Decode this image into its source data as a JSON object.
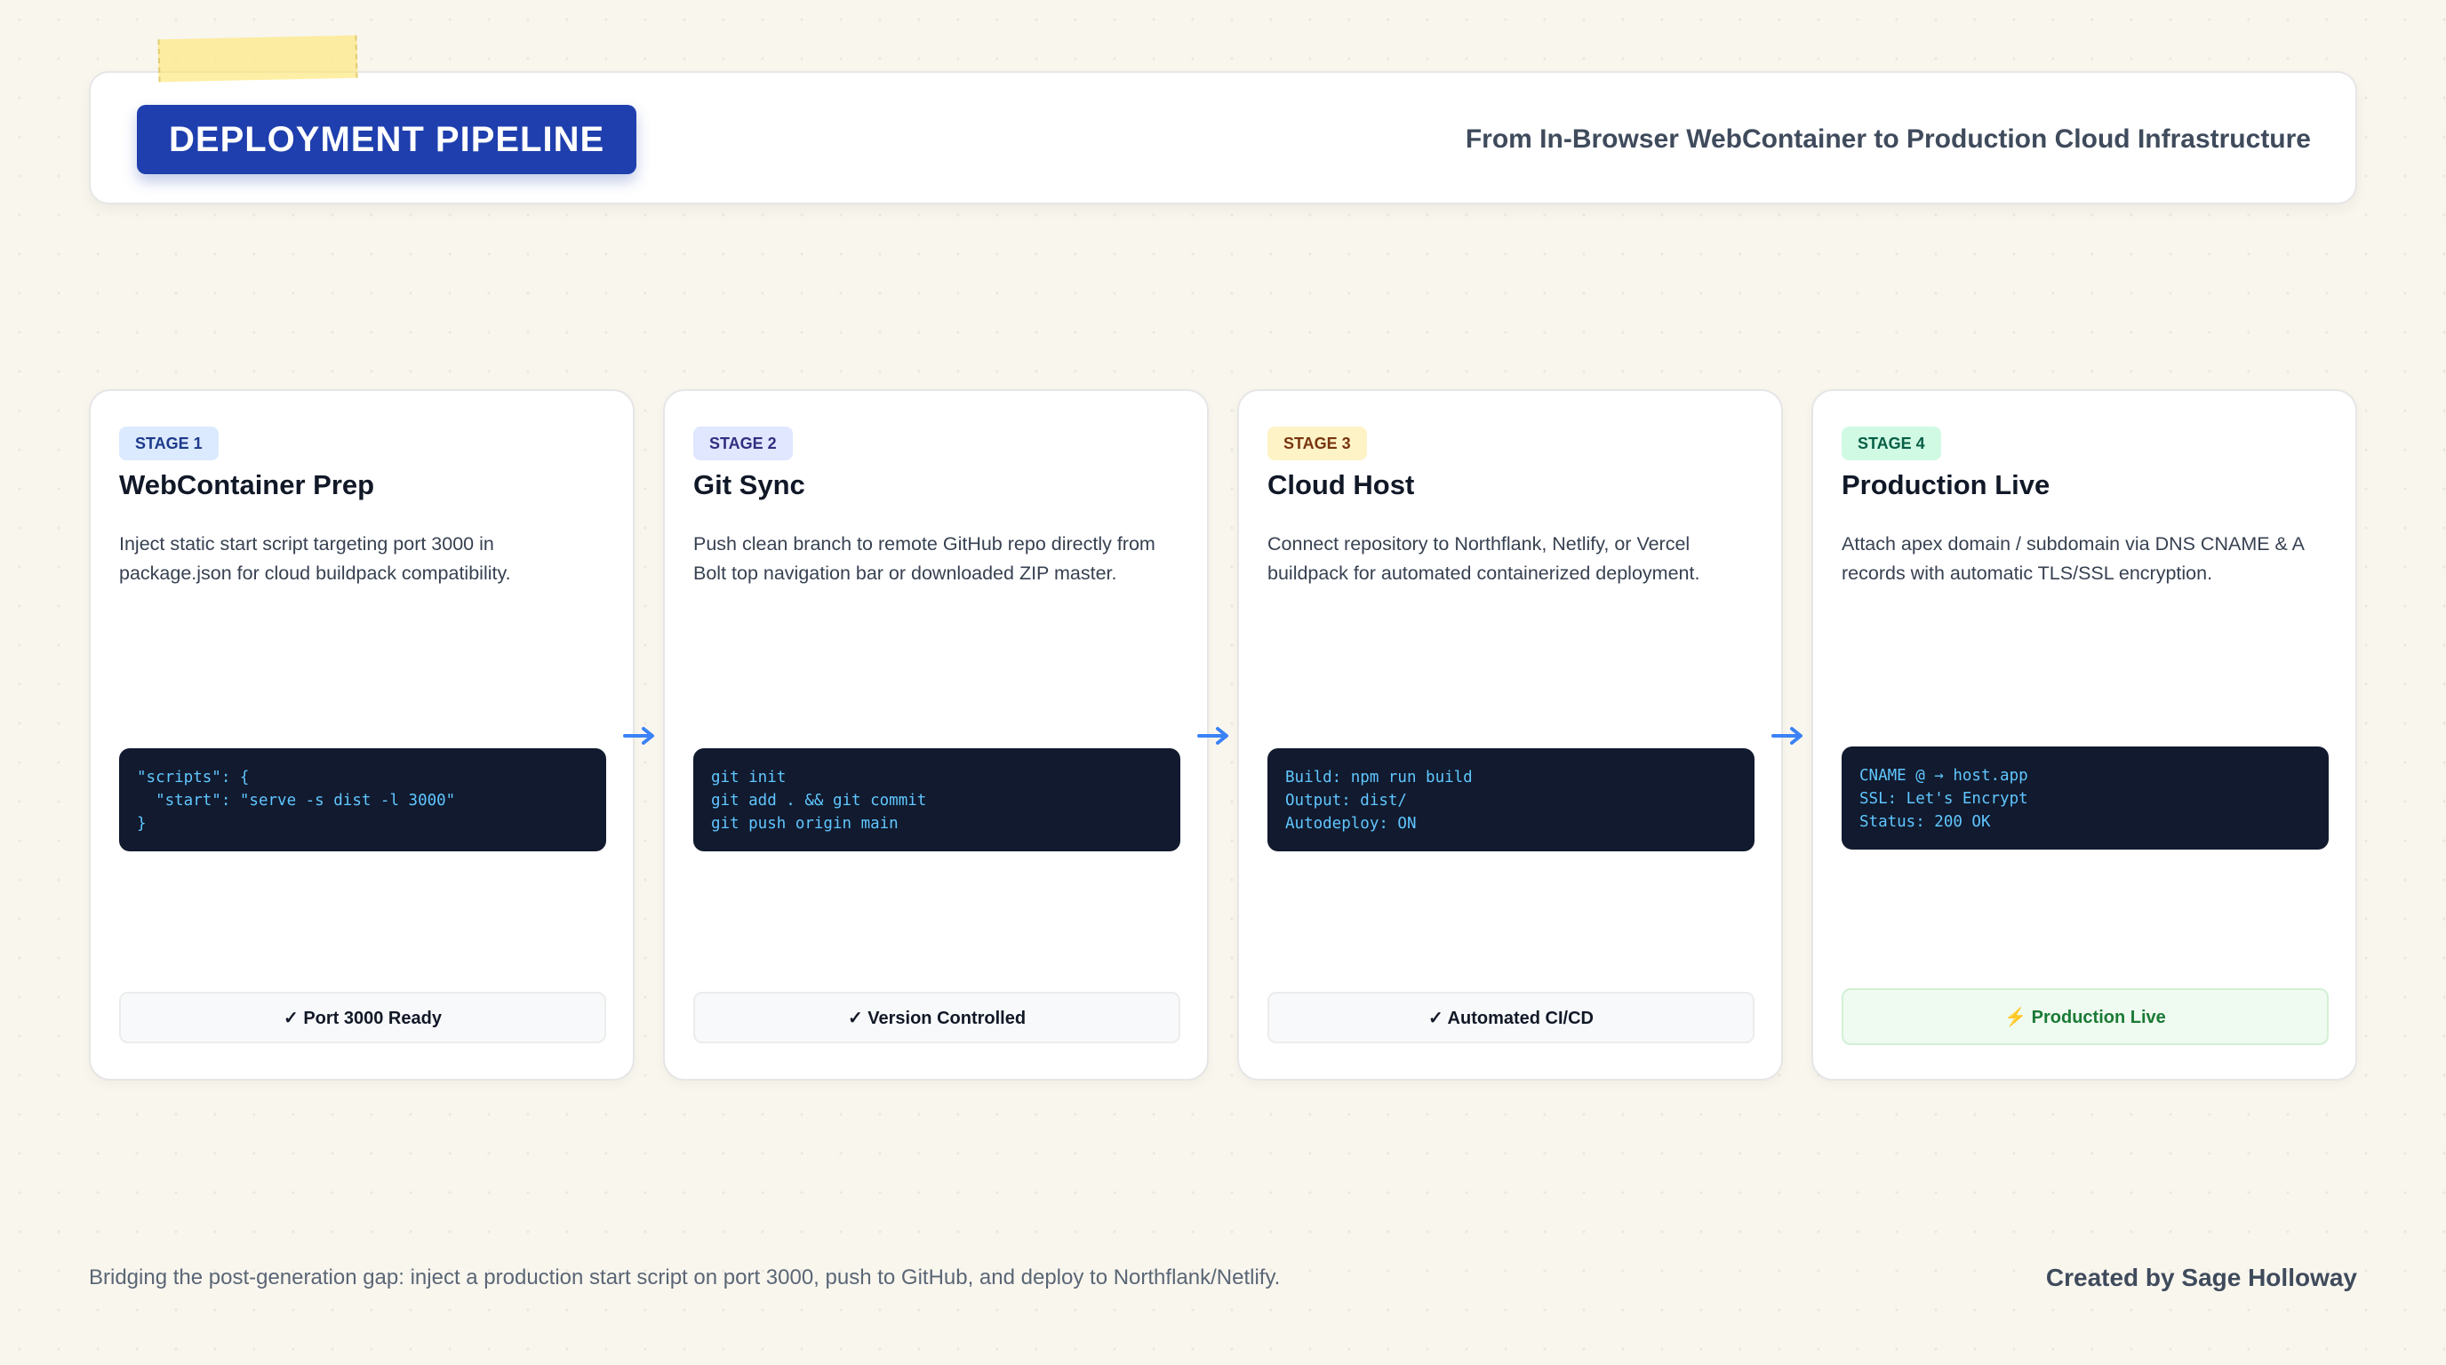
{
  "header": {
    "title": "DEPLOYMENT PIPELINE",
    "subtitle": "From In-Browser WebContainer to Production Cloud Infrastructure"
  },
  "colors": {
    "title_badge": "#1f3fae",
    "arrow": "#3b82f6",
    "code_bg": "#111a2e",
    "code_text": "#60c6ff",
    "stage1_badge_bg": "#dbeafe",
    "stage1_badge_text": "#1e3a8a",
    "stage2_badge_bg": "#e0e7ff",
    "stage2_badge_text": "#312e81",
    "stage3_badge_bg": "#fef3c7",
    "stage3_badge_text": "#78350f",
    "stage4_badge_bg": "#d1fae5",
    "stage4_badge_text": "#065f46"
  },
  "stages": [
    {
      "badge": "STAGE 1",
      "title": "WebContainer Prep",
      "description": "Inject static start script targeting port 3000 in package.json for cloud buildpack compatibility.",
      "code": [
        "\"scripts\": {",
        "  \"start\": \"serve -s dist -l 3000\"",
        "}"
      ],
      "status": "✓ Port 3000 Ready"
    },
    {
      "badge": "STAGE 2",
      "title": "Git Sync",
      "description": "Push clean branch to remote GitHub repo directly from Bolt top navigation bar or downloaded ZIP master.",
      "code": [
        "git init",
        "git add . && git commit",
        "git push origin main"
      ],
      "status": "✓ Version Controlled"
    },
    {
      "badge": "STAGE 3",
      "title": "Cloud Host",
      "description": "Connect repository to Northflank, Netlify, or Vercel buildpack for automated containerized deployment.",
      "code": [
        "Build: npm run build",
        "Output: dist/",
        "Autodeploy: ON"
      ],
      "status": "✓ Automated CI/CD"
    },
    {
      "badge": "STAGE 4",
      "title": "Production Live",
      "description": "Attach apex domain / subdomain via DNS CNAME & A records with automatic TLS/SSL encryption.",
      "code": [
        "CNAME @ → host.app",
        "SSL: Let's Encrypt",
        "Status: 200 OK"
      ],
      "status": "⚡ Production Live"
    }
  ],
  "footer": {
    "note": "Bridging the post-generation gap: inject a production start script on port 3000, push to GitHub, and deploy to Northflank/Netlify.",
    "credit": "Created by Sage Holloway"
  }
}
